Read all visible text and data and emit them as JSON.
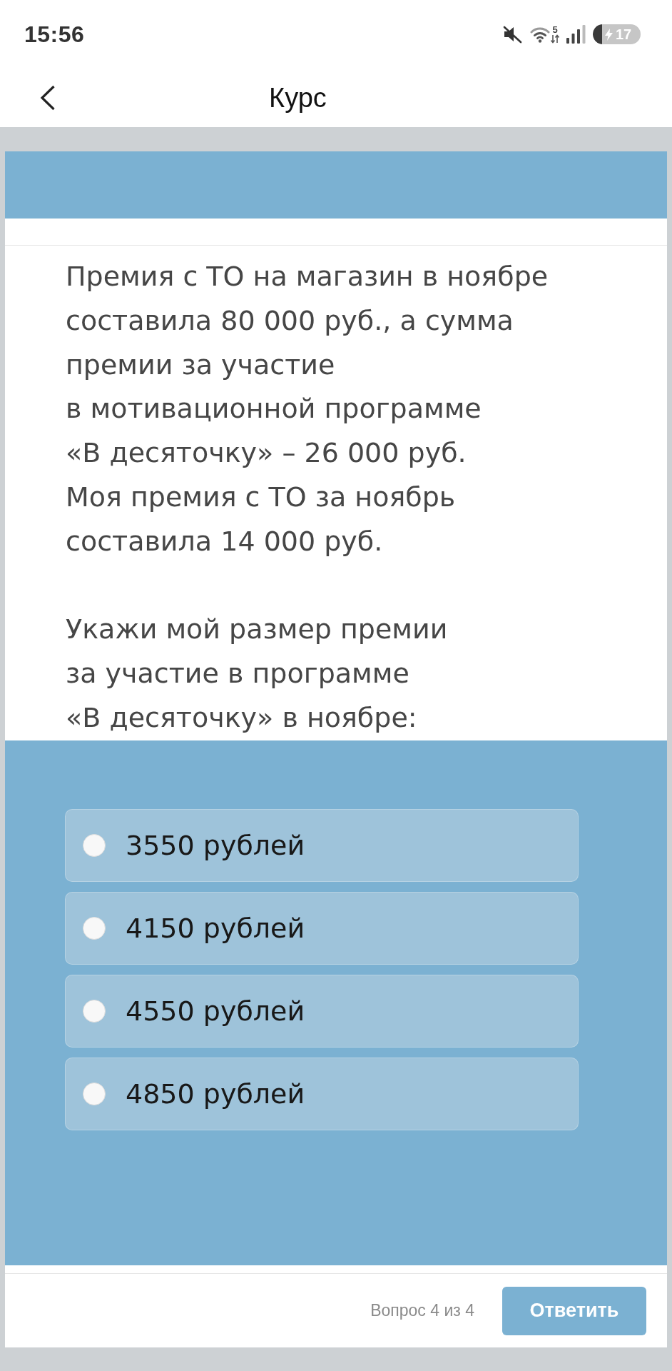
{
  "status_bar": {
    "time": "15:56",
    "wifi_badge": "5",
    "battery_percent": "17"
  },
  "header": {
    "title": "Курс"
  },
  "question": {
    "paragraphs": [
      [
        "Премия с ТО на магазин в ноябре",
        "составила 80 000 руб., а сумма",
        "премии за участие",
        "в мотивационной программе",
        "«В десяточку» – 26 000 руб.",
        "Моя премия с ТО за ноябрь",
        "составила 14 000 руб."
      ],
      [
        "Укажи мой размер премии",
        "за участие в программе",
        "«В десяточку» в ноябре:"
      ]
    ]
  },
  "options": [
    {
      "label": "3550 рублей",
      "selected": false
    },
    {
      "label": "4150 рублей",
      "selected": false
    },
    {
      "label": "4550 рублей",
      "selected": false
    },
    {
      "label": "4850 рублей",
      "selected": false
    }
  ],
  "footer": {
    "progress": "Вопрос 4 из 4",
    "submit": "Ответить"
  }
}
